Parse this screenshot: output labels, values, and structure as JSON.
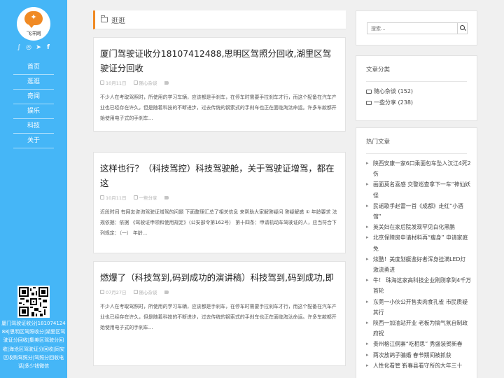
{
  "sidebar": {
    "logo_text": "飞洋网",
    "nav": [
      "首页",
      "逛逛",
      "奇闻",
      "娱乐",
      "科技",
      "关于"
    ],
    "note": "厦门驾驶证收分|18107412488|思明区驾照收分|湖里区驾驶证分回收|集美区驾驶分回收|海沧区驾驶证分回收|同安区收购驾照分|驾照分回收电话|多少钱微信"
  },
  "breadcrumb": {
    "label": "逛逛"
  },
  "posts": [
    {
      "title": "厦门驾驶证收分18107412488,思明区驾照分回收,湖里区驾驶证分回收",
      "date": "10月11日",
      "category": "随心杂谈",
      "excerpt": "不少人在考取驾照时，所使用的学习车辆，应该都是手刹车，在停车时需要手拉刹车才行，而这个配备在汽车产业也已经存在许久，但是随着科技的不断进步，过去传统的钢索式的手刹车也正在面临淘汰命运。许多车款都开始使用电子式的手刹车..."
    },
    {
      "title": "这样也行？（科技驾控）科技驾驶舱，关于驾驶证增驾，都在这",
      "date": "10月11日",
      "category": "一些分享",
      "excerpt": "近段时间 有网友咨询驾驶证增驾的问题 下面整理汇总了相关信息 来帮助大家解答疑问 答疑解惑 ① 年龄要求 法规依据：依据 《驾驶证申领和使用规定》（公安部令第162号） 第十四条：申请机动车驾驶证的人，应当符合下列规定：（一） 年龄..."
    },
    {
      "title": "燃爆了（科技驾到,码到成功的演讲稿）科技驾到,码到成功,即",
      "date": "07月27日",
      "category": "随心杂谈",
      "excerpt": "不少人在考取驾照时，所使用的学习车辆，应该都是手刹车，在停车时需要手拉刹车才行，而这个配备在汽车产业也已经存在许久，但是随着科技的不断进步，过去传统的钢索式的手刹车也正在面临淘汰命运。许多车款都开始使用电子式的手刹车..."
    }
  ],
  "search": {
    "placeholder": "搜索..."
  },
  "categories": {
    "title": "文章分类",
    "items": [
      "随心杂谈 (152)",
      "一些分享 (238)"
    ]
  },
  "hot": {
    "title": "热门文章",
    "items": [
      "陕西安康一家6口乘面包车坠入汉江4死2伤",
      "画面莫名喜感 交警巡查拿下一车“神仙妖怪",
      "民谣歌手赵雷一首《成都》走红“小酒馆”",
      "英关妇在家后院发现罕见白化黑鹏",
      "北京保障房申请材料再“瘦身” 申请家庭免",
      "炫酷！美度划艇鉴好者浑身挂满LED灯激流勇进",
      "牛！ 珠海这家高科技企业刚刚拿到4千万首轮",
      "东莞一小伙公开售卖肉食孔雀 市民质疑其行",
      "陕西一加油站开业 老板为搞气氛自制政府祝",
      "贵州榕江侗寨“吃相思” 秀盛装贺新春",
      "两次放鸽子骗婚 春节期间被抓获",
      "人性化看管 靳春县看守所的大年三十"
    ]
  }
}
